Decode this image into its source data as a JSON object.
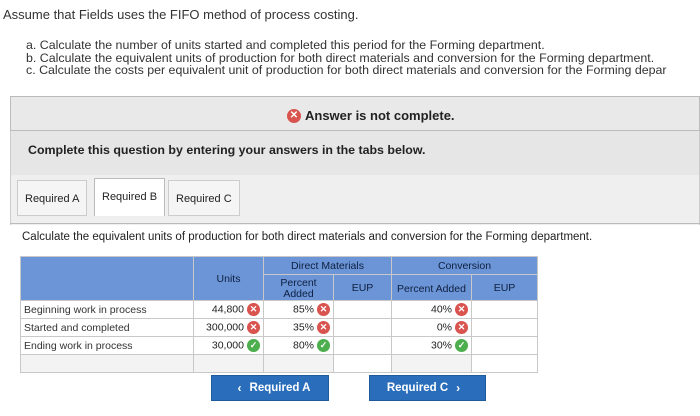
{
  "intro": "Assume that Fields uses the FIFO method of process costing.",
  "parts": [
    {
      "letter": "a.",
      "text": " Calculate the number of units started and completed this period for the Forming department."
    },
    {
      "letter": "b.",
      "text": " Calculate the equivalent units of production for both direct materials and conversion for the Forming department."
    },
    {
      "letter": "c.",
      "text": " Calculate the costs per equivalent unit of production for both direct materials and conversion for the Forming depar"
    }
  ],
  "banner": {
    "text": "Answer is not complete.",
    "icon": "x-circle-icon",
    "color": "#d9534f"
  },
  "panel_title": "Complete this question by entering your answers in the tabs below.",
  "tabs": [
    "Required A",
    "Required B",
    "Required C"
  ],
  "active_tab": "Required B",
  "instruction": "Calculate the equivalent units of production for both direct materials and conversion for the Forming department.",
  "table": {
    "headers": {
      "units": "Units",
      "direct_materials": "Direct Materials",
      "conversion": "Conversion",
      "percent_added": "Percent Added",
      "eup": "EUP"
    },
    "rows": [
      {
        "label": "Beginning work in process",
        "units": "44,800",
        "units_status": "incorrect",
        "dm_pct": "85%",
        "dm_status": "incorrect",
        "dm_eup": "",
        "cv_pct": "40%",
        "cv_status": "incorrect",
        "cv_eup": ""
      },
      {
        "label": "Started and completed",
        "units": "300,000",
        "units_status": "incorrect",
        "dm_pct": "35%",
        "dm_status": "incorrect",
        "dm_eup": "",
        "cv_pct": "0%",
        "cv_status": "incorrect",
        "cv_eup": ""
      },
      {
        "label": "Ending work in process",
        "units": "30,000",
        "units_status": "correct",
        "dm_pct": "80%",
        "dm_status": "correct",
        "dm_eup": "",
        "cv_pct": "30%",
        "cv_status": "correct",
        "cv_eup": ""
      },
      {
        "label": "",
        "units": "",
        "dm_pct": "",
        "dm_eup": "",
        "cv_pct": "",
        "cv_eup": ""
      }
    ]
  },
  "nav": {
    "prev_label": "Required A",
    "next_label": "Required C"
  },
  "colors": {
    "header_blue": "#6b95d6",
    "button_blue": "#2a6ebb",
    "error_red": "#d9534f",
    "ok_green": "#4cae4c"
  }
}
